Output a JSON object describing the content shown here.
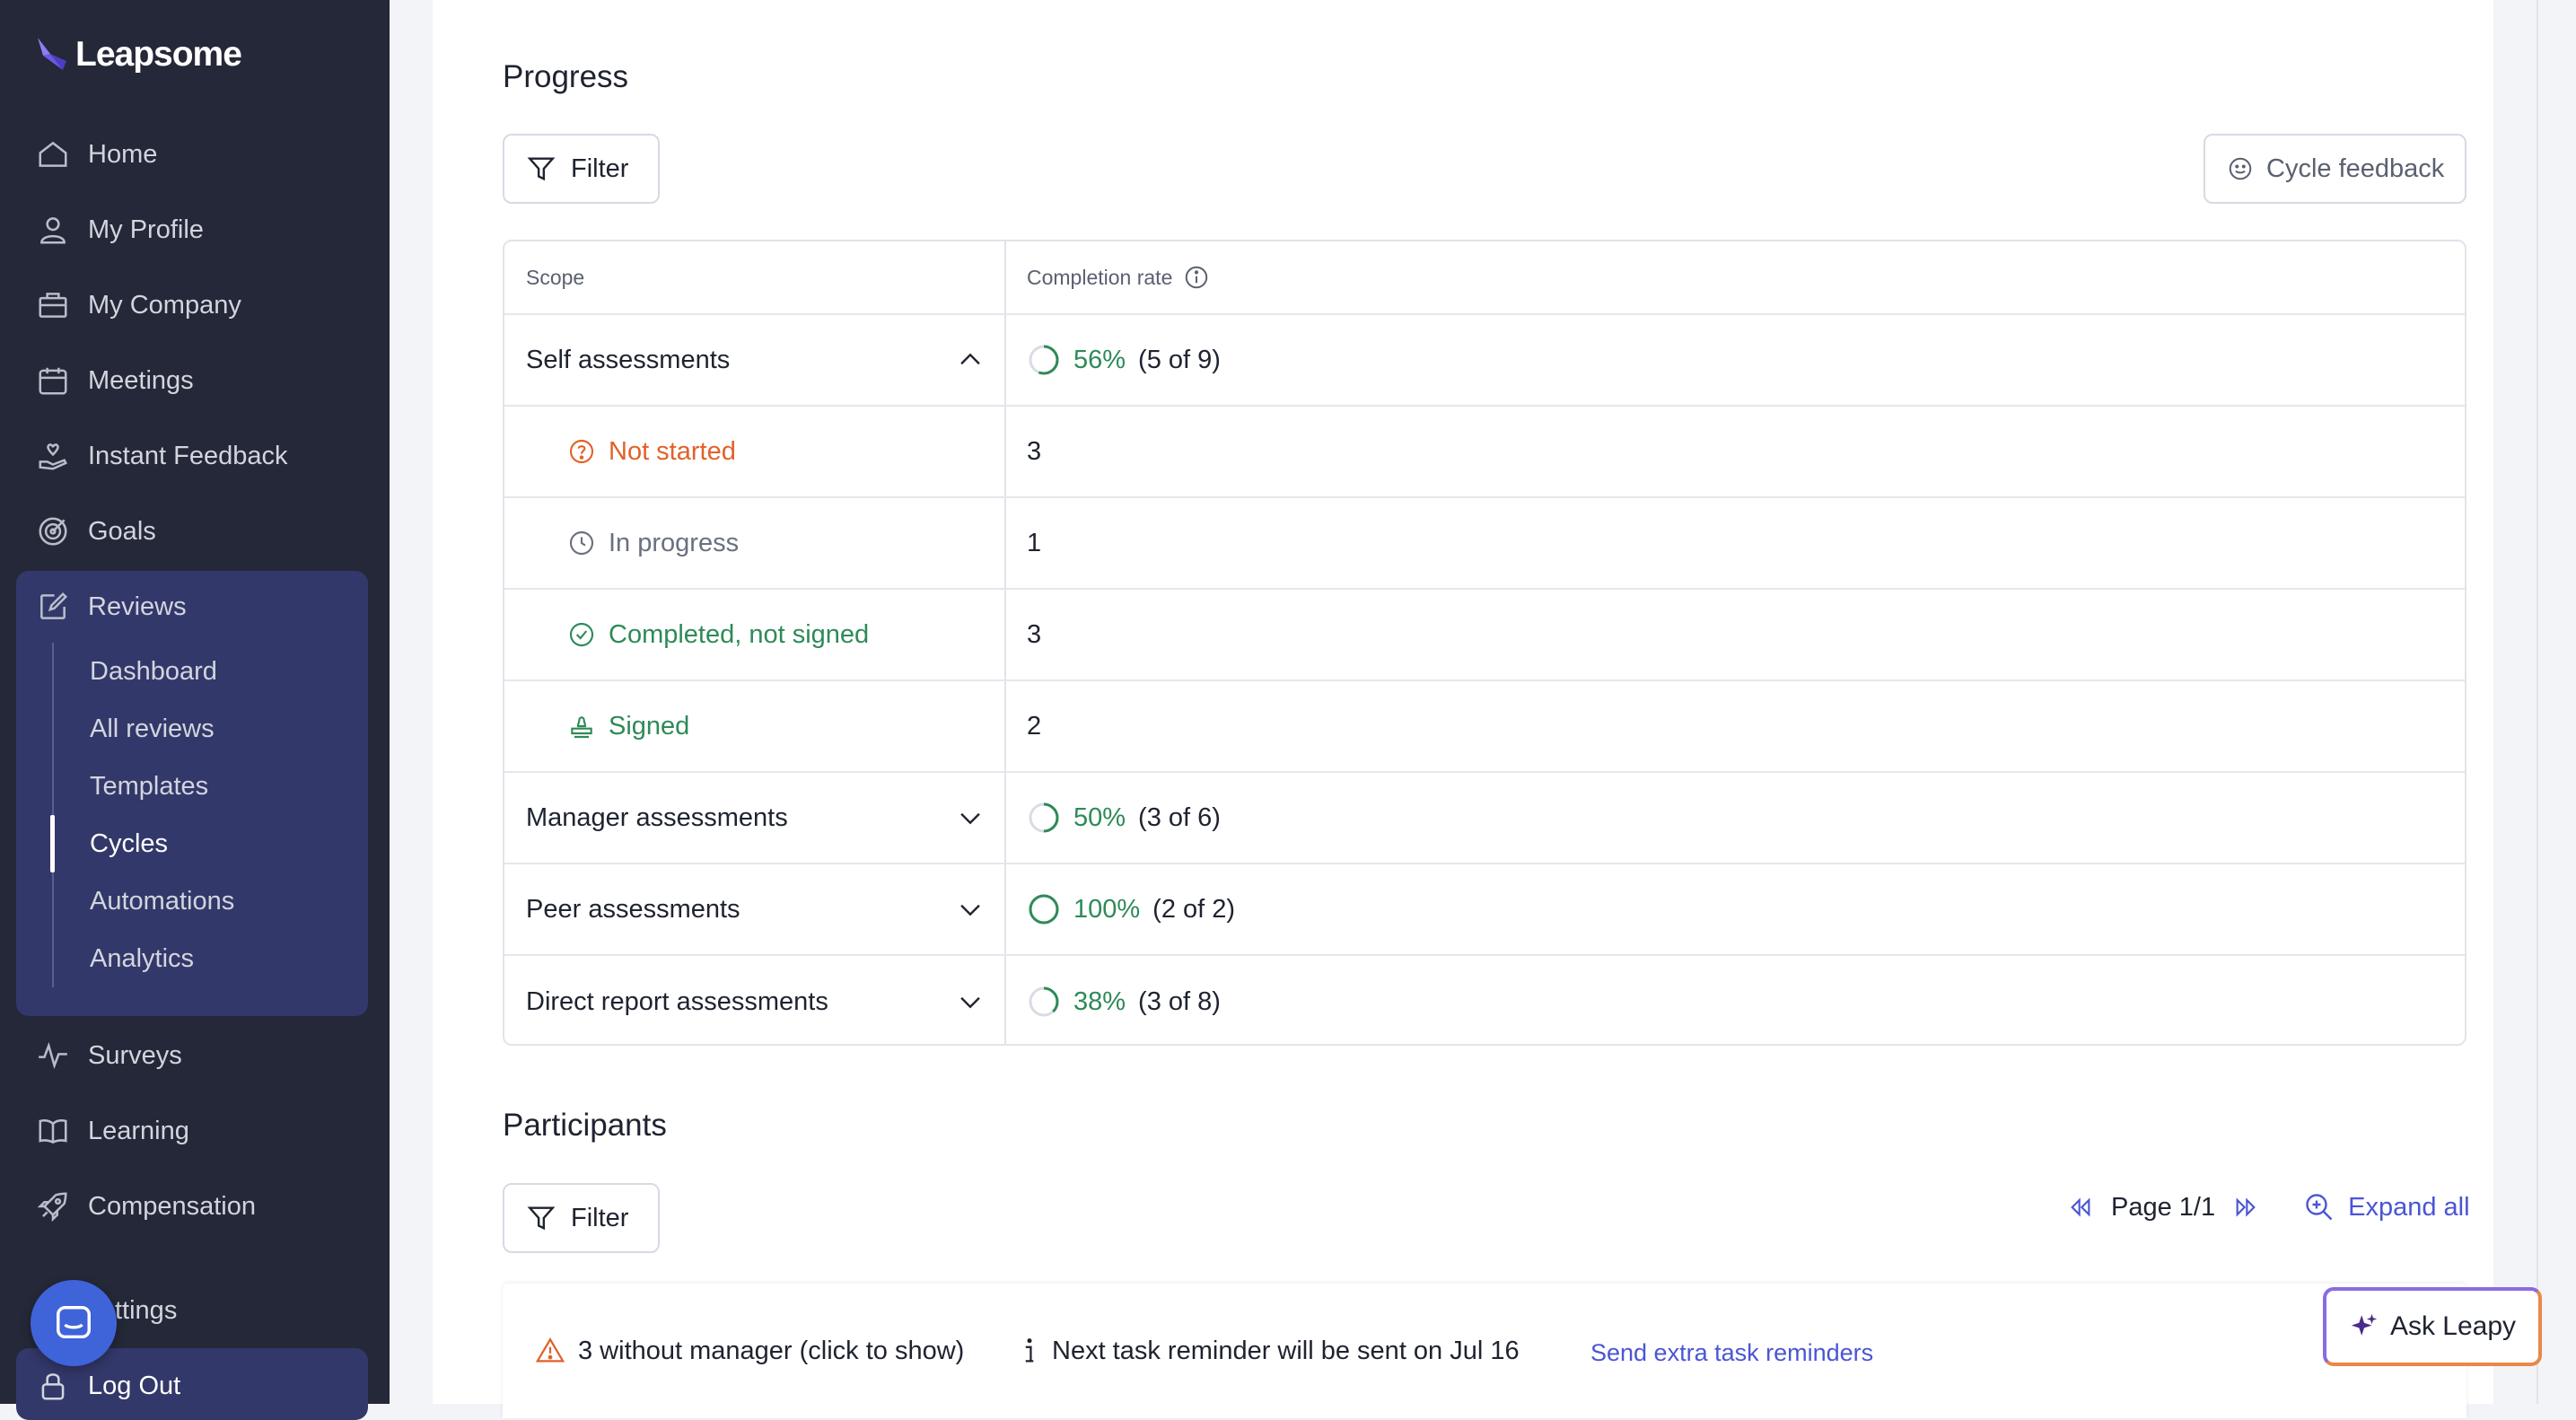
{
  "app": {
    "logo_text": "Leapsome"
  },
  "sidebar": {
    "items": [
      {
        "label": "Home",
        "icon": "home-icon"
      },
      {
        "label": "My Profile",
        "icon": "user-icon"
      },
      {
        "label": "My Company",
        "icon": "building-icon"
      },
      {
        "label": "Meetings",
        "icon": "calendar-icon"
      },
      {
        "label": "Instant Feedback",
        "icon": "hand-heart-icon"
      },
      {
        "label": "Goals",
        "icon": "target-icon"
      },
      {
        "label": "Reviews",
        "icon": "edit-icon"
      },
      {
        "label": "Surveys",
        "icon": "pulse-icon"
      },
      {
        "label": "Learning",
        "icon": "book-icon"
      },
      {
        "label": "Compensation",
        "icon": "rocket-icon"
      },
      {
        "label": "Settings",
        "icon": "gear-icon",
        "visible_label": "ttings"
      },
      {
        "label": "Log Out",
        "icon": "lock-icon"
      }
    ],
    "reviews_sub": [
      "Dashboard",
      "All reviews",
      "Templates",
      "Cycles",
      "Automations",
      "Analytics"
    ],
    "active_sub": "Cycles"
  },
  "progress": {
    "title": "Progress",
    "filter_label": "Filter",
    "cycle_feedback_label": "Cycle feedback",
    "table": {
      "headers": {
        "scope": "Scope",
        "rate": "Completion rate"
      },
      "rows": [
        {
          "scope": "Self assessments",
          "pct": "56%",
          "count": "(5 of 9)",
          "expanded": true,
          "progress": 0.56
        },
        {
          "scope": "Not started",
          "status": "not-started",
          "value": "3"
        },
        {
          "scope": "In progress",
          "status": "in-progress",
          "value": "1"
        },
        {
          "scope": "Completed, not signed",
          "status": "completed",
          "value": "3"
        },
        {
          "scope": "Signed",
          "status": "signed",
          "value": "2"
        },
        {
          "scope": "Manager assessments",
          "pct": "50%",
          "count": "(3 of 6)",
          "expanded": false,
          "progress": 0.5
        },
        {
          "scope": "Peer assessments",
          "pct": "100%",
          "count": "(2 of 2)",
          "expanded": false,
          "progress": 1.0
        },
        {
          "scope": "Direct report assessments",
          "pct": "38%",
          "count": "(3 of 8)",
          "expanded": false,
          "progress": 0.38
        }
      ]
    }
  },
  "participants": {
    "title": "Participants",
    "filter_label": "Filter",
    "page_label": "Page 1/1",
    "expand_all_label": "Expand all",
    "without_manager": "3 without manager (click to show)",
    "reminder_text": "Next task reminder will be sent on Jul 16",
    "send_reminders_label": "Send extra task reminders"
  },
  "ask_leapy": {
    "label": "Ask Leapy"
  },
  "colors": {
    "sidebar_bg": "#242838",
    "sidebar_active_bg": "#33386a",
    "accent_green": "#2e8a57",
    "accent_orange": "#e2612a",
    "link_blue": "#4a55d4"
  }
}
